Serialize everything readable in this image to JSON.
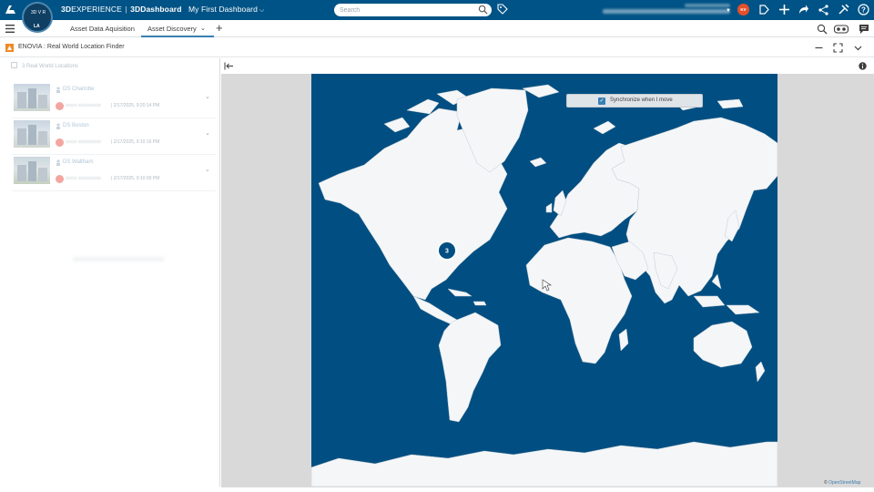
{
  "topbar": {
    "brand_prefix": "3D",
    "brand_name": "EXPERIENCE",
    "brand_separator": "|",
    "app_prefix": "3D",
    "app_name": "Dashboard",
    "dashboard_name": "My First Dashboard",
    "search_placeholder": "Search",
    "compass_initials": "LA",
    "compass_letters": "3D V R",
    "avatar_initials": "KV",
    "colors": {
      "bar": "#005386",
      "avatar": "#e4502a"
    }
  },
  "tabs": {
    "items": [
      {
        "label": "Asset Data Aquisition",
        "active": false
      },
      {
        "label": "Asset Discovery",
        "active": true
      }
    ],
    "add_label": "+"
  },
  "widget": {
    "title": "ENOVIA : Real World Location Finder"
  },
  "left_panel": {
    "count_label": "3 Real World Locations",
    "locations": [
      {
        "name": "DS Charlotte",
        "date": "| 2/17/2025, 9:20:14 PM"
      },
      {
        "name": "DS Boston",
        "date": "| 2/17/2025, 9:10:16 PM"
      },
      {
        "name": "DS Waltham",
        "date": "| 2/17/2025, 9:10:00 PM"
      }
    ]
  },
  "map": {
    "sync_label": "Synchronize when I move",
    "sync_checked": true,
    "cluster_count": "3",
    "attribution_prefix": "©",
    "attribution_source": "OpenStreetMap",
    "colors": {
      "ocean": "#014f82",
      "land": "#f4f6f8",
      "border": "#c5ccd3"
    }
  }
}
